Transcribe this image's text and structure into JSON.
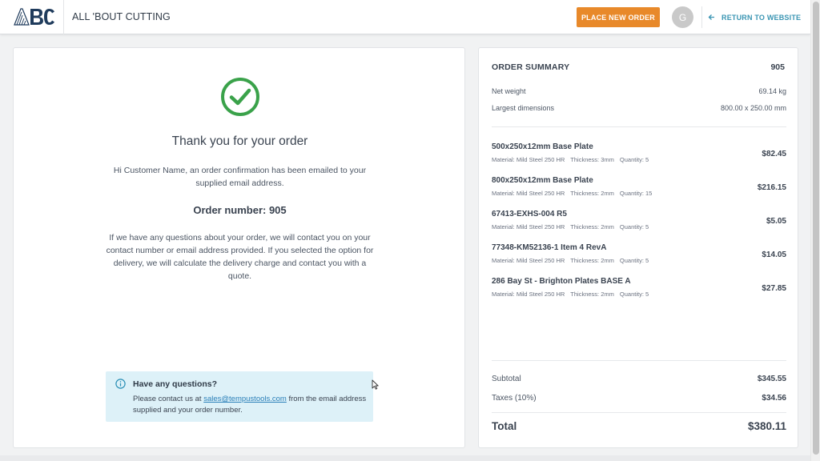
{
  "header": {
    "logo_text": "ABC",
    "app_name": "ALL 'BOUT CUTTING",
    "place_order_label": "PLACE NEW ORDER",
    "avatar_initial": "G",
    "return_label": "RETURN TO WEBSITE"
  },
  "confirmation": {
    "title": "Thank you for your order",
    "message": "Hi Customer Name, an order confirmation has been emailed to your supplied email address.",
    "order_number_label": "Order number: ",
    "order_number": "905",
    "info": "If we have any questions about your order, we will contact you on your contact number or email address provided. If you selected the option for delivery, we will calculate the delivery charge and contact you with a quote."
  },
  "help": {
    "title": "Have any questions?",
    "text_before": "Please contact us at ",
    "email": "sales@tempustools.com",
    "text_after": " from the email address supplied and your order number."
  },
  "summary": {
    "title": "ORDER SUMMARY",
    "order_number": "905",
    "net_weight_label": "Net weight",
    "net_weight": "69.14 kg",
    "dimensions_label": "Largest dimensions",
    "dimensions": "800.00 x 250.00 mm",
    "items": [
      {
        "name": "500x250x12mm Base Plate",
        "material": "Material: Mild Steel 250 HR",
        "thickness": "Thickness: 3mm",
        "quantity": "Quantity: 5",
        "price": "$82.45"
      },
      {
        "name": "800x250x12mm Base Plate",
        "material": "Material: Mild Steel 250 HR",
        "thickness": "Thickness: 2mm",
        "quantity": "Quantity: 15",
        "price": "$216.15"
      },
      {
        "name": "67413-EXHS-004 R5",
        "material": "Material: Mild Steel 250 HR",
        "thickness": "Thickness: 2mm",
        "quantity": "Quantity: 5",
        "price": "$5.05"
      },
      {
        "name": "77348-KM52136-1 Item 4 RevA",
        "material": "Material: Mild Steel 250 HR",
        "thickness": "Thickness: 2mm",
        "quantity": "Quantity: 5",
        "price": "$14.05"
      },
      {
        "name": "286 Bay St - Brighton Plates BASE A",
        "material": "Material: Mild Steel 250 HR",
        "thickness": "Thickness: 2mm",
        "quantity": "Quantity: 5",
        "price": "$27.85"
      }
    ],
    "subtotal_label": "Subtotal",
    "subtotal": "$345.55",
    "taxes_label": "Taxes (10%)",
    "taxes": "$34.56",
    "total_label": "Total",
    "total": "$380.11"
  },
  "colors": {
    "accent_orange": "#e8892a",
    "link_blue": "#3a95b3",
    "success_green": "#3aa24a",
    "help_bg": "#ddf1f8",
    "logo_navy": "#1f3b5c"
  }
}
